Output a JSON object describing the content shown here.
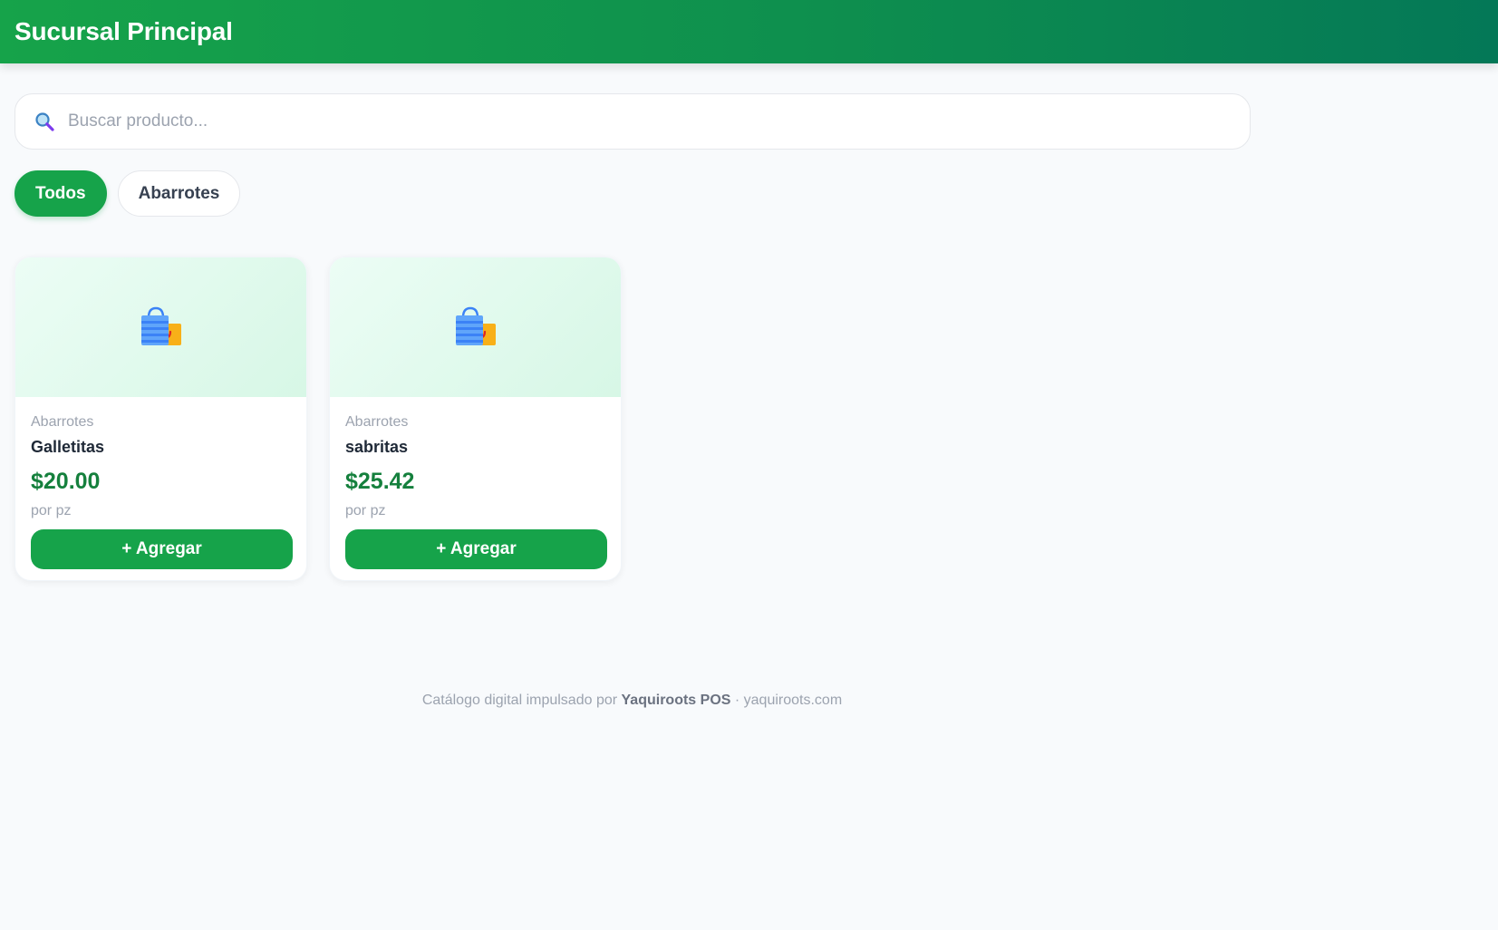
{
  "header": {
    "title": "Sucursal Principal"
  },
  "search": {
    "placeholder": "Buscar producto...",
    "value": "",
    "icon": "magnifier-icon"
  },
  "categories": [
    {
      "label": "Todos",
      "active": true
    },
    {
      "label": "Abarrotes",
      "active": false
    }
  ],
  "products": [
    {
      "category": "Abarrotes",
      "name": "Galletitas",
      "price": "$20.00",
      "unit": "por pz",
      "add_label": "+ Agregar",
      "icon": "shopping-bags-icon"
    },
    {
      "category": "Abarrotes",
      "name": "sabritas",
      "price": "$25.42",
      "unit": "por pz",
      "add_label": "+ Agregar",
      "icon": "shopping-bags-icon"
    }
  ],
  "footer": {
    "prefix": "Catálogo digital impulsado por ",
    "brand": "Yaquiroots POS",
    "suffix": " · yaquiroots.com"
  },
  "colors": {
    "primary": "#16a34a",
    "price": "#15803d",
    "header_end": "#047857"
  }
}
